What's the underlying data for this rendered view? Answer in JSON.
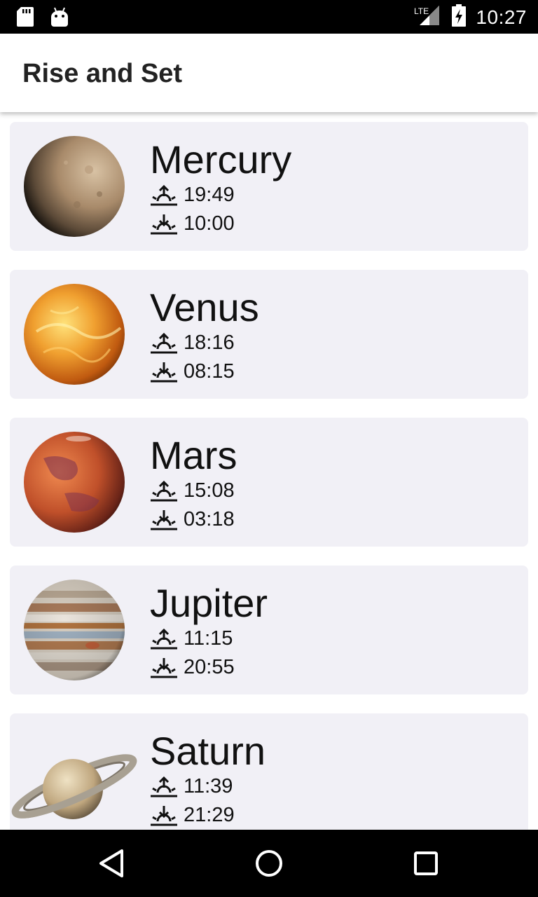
{
  "status_bar": {
    "time": "10:27",
    "network": "LTE",
    "icons": [
      "sd-card-icon",
      "android-debug-icon",
      "lte-signal-icon",
      "battery-charging-icon"
    ]
  },
  "app_bar": {
    "title": "Rise and Set"
  },
  "planets": [
    {
      "name": "Mercury",
      "rise": "19:49",
      "set": "10:00"
    },
    {
      "name": "Venus",
      "rise": "18:16",
      "set": "08:15"
    },
    {
      "name": "Mars",
      "rise": "15:08",
      "set": "03:18"
    },
    {
      "name": "Jupiter",
      "rise": "11:15",
      "set": "20:55"
    },
    {
      "name": "Saturn",
      "rise": "11:39",
      "set": "21:29"
    }
  ],
  "icons": {
    "rise": "sunrise-icon",
    "set": "sunset-icon"
  },
  "nav_bar": {
    "buttons": [
      "back-icon",
      "home-icon",
      "recents-icon"
    ]
  },
  "colors": {
    "card_background": "#f1f0f6",
    "status_bar": "#000000",
    "app_bar": "#ffffff"
  }
}
